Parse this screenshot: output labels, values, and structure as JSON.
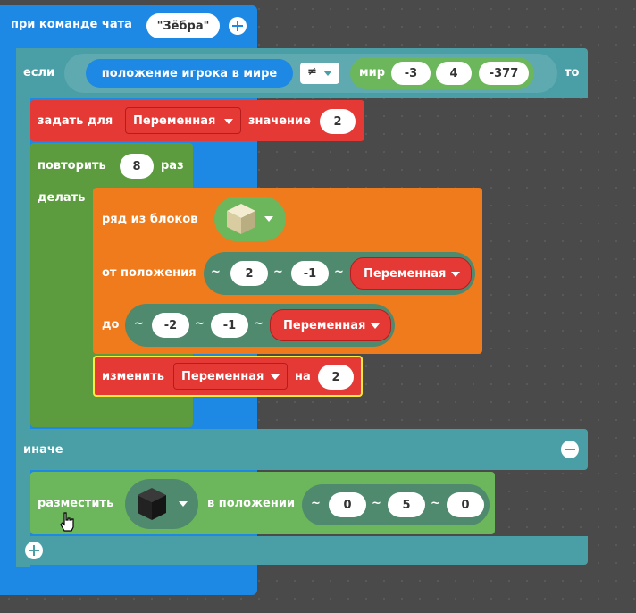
{
  "colors": {
    "event": "#1e88e5",
    "logic": "#4a9fa6",
    "variable": "#e53935",
    "loop": "#5c9c3f",
    "blocks": "#ef7b1c",
    "position": "#4f8a6e",
    "world": "#6cb65c",
    "canvas": "#4a4a4a"
  },
  "chat_event": {
    "label": "при команде чата",
    "command_value": "\"Зёбра\""
  },
  "if_block": {
    "label_if": "если",
    "label_then": "то",
    "label_else": "иначе",
    "condition_left": "положение игрока в мире",
    "operator": "≠",
    "world_label": "мир",
    "world_x": "-3",
    "world_y": "4",
    "world_z": "-377"
  },
  "set_var": {
    "label": "задать для",
    "variable": "Переменная",
    "label_value": "значение",
    "value": "2"
  },
  "repeat": {
    "label": "повторить",
    "count": "8",
    "label_times": "раз",
    "label_do": "делать"
  },
  "fill_row": {
    "label": "ряд из блоков",
    "block_icon": "sand-block-icon",
    "label_from": "от положения",
    "from_x": "2",
    "from_y": "-1",
    "from_z_var": "Переменная",
    "label_to": "до",
    "to_x": "-2",
    "to_y": "-1",
    "to_z_var": "Переменная",
    "tilde": "~"
  },
  "change_var": {
    "label": "изменить",
    "variable": "Переменная",
    "label_by": "на",
    "value": "2"
  },
  "place_block": {
    "label": "разместить",
    "block_icon": "obsidian-block-icon",
    "label_at": "в положении",
    "x": "0",
    "y": "5",
    "z": "0"
  }
}
